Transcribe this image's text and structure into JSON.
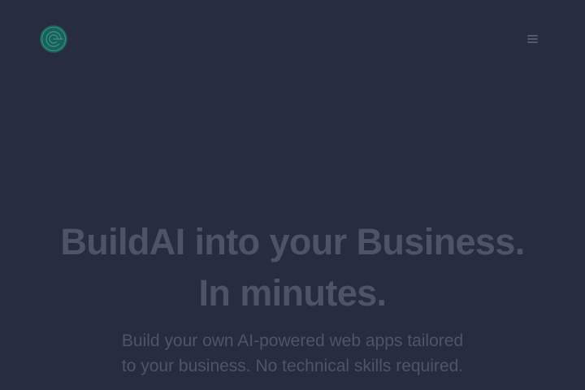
{
  "header": {
    "logo_icon": "circular-swirl-logo-icon",
    "menu_icon": "hamburger-menu-icon"
  },
  "hero": {
    "title_line1": "BuildAI into your Business.",
    "title_line2": "In minutes.",
    "subtitle_line1": "Build your own AI-powered web apps tailored",
    "subtitle_line2": "to your business. No technical skills required."
  },
  "colors": {
    "background": "#272c3f",
    "logo_accent": "#1f6f66",
    "muted_text": "#4e5466"
  }
}
